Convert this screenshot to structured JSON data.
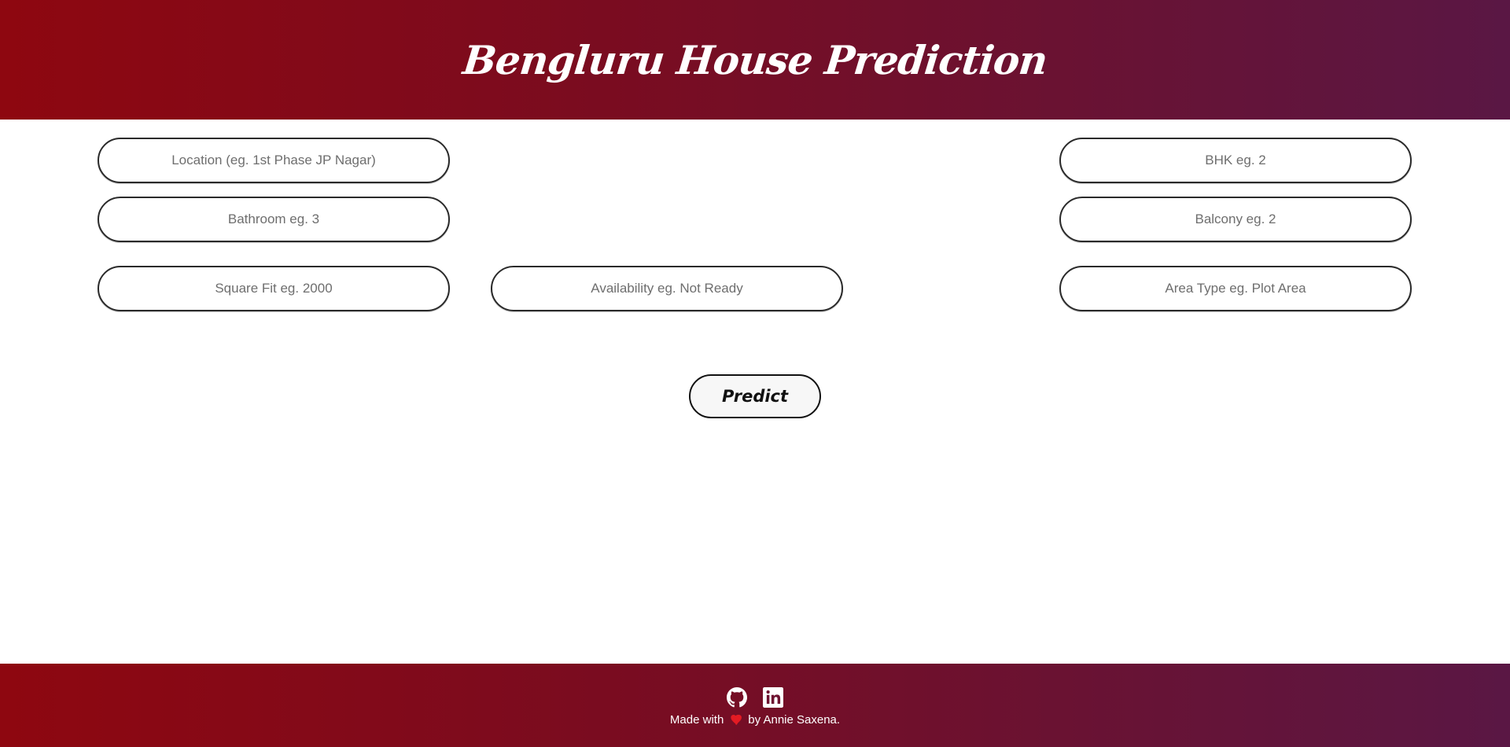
{
  "header": {
    "title": "Bengluru House Prediction"
  },
  "form": {
    "location_placeholder": "Location (eg. 1st Phase JP Nagar)",
    "bhk_placeholder": "BHK eg. 2",
    "bathroom_placeholder": "Bathroom eg. 3",
    "balcony_placeholder": "Balcony eg. 2",
    "sqft_placeholder": "Square Fit eg. 2000",
    "availability_placeholder": "Availability eg. Not Ready",
    "areatype_placeholder": "Area Type eg. Plot Area",
    "predict_label": "Predict"
  },
  "footer": {
    "made_with": "Made with",
    "by_text": "by Annie Saxena.",
    "icons": [
      "github-icon",
      "linkedin-icon",
      "heart-icon"
    ],
    "heart_color": "#e31b23"
  },
  "colors": {
    "gradient_start": "#8e0710",
    "gradient_end": "#5a1744"
  }
}
